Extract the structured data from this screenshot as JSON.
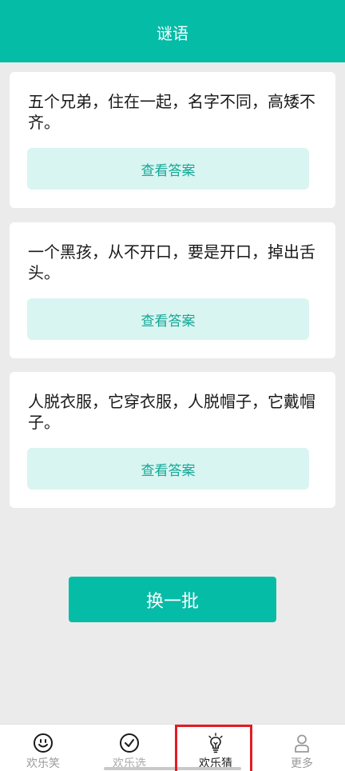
{
  "header": {
    "title": "谜语"
  },
  "riddles": [
    {
      "text": "五个兄弟，住在一起，名字不同，高矮不齐。",
      "button_label": "查看答案"
    },
    {
      "text": "一个黑孩，从不开口，要是开口，掉出舌头。",
      "button_label": "查看答案"
    },
    {
      "text": "人脱衣服，它穿衣服，人脱帽子，它戴帽子。",
      "button_label": "查看答案"
    }
  ],
  "refresh": {
    "label": "换一批"
  },
  "tabbar": {
    "tabs": [
      {
        "label": "欢乐笑",
        "icon": "smiley-face-icon"
      },
      {
        "label": "欢乐选",
        "icon": "check-circle-icon"
      },
      {
        "label": "欢乐猜",
        "icon": "lightbulb-icon",
        "active": true
      },
      {
        "label": "更多",
        "icon": "user-icon"
      }
    ]
  },
  "colors": {
    "primary": "#05bca7",
    "answer_button_bg": "#d9f5f1",
    "answer_button_text": "#16a897",
    "highlight": "#e31c23"
  }
}
